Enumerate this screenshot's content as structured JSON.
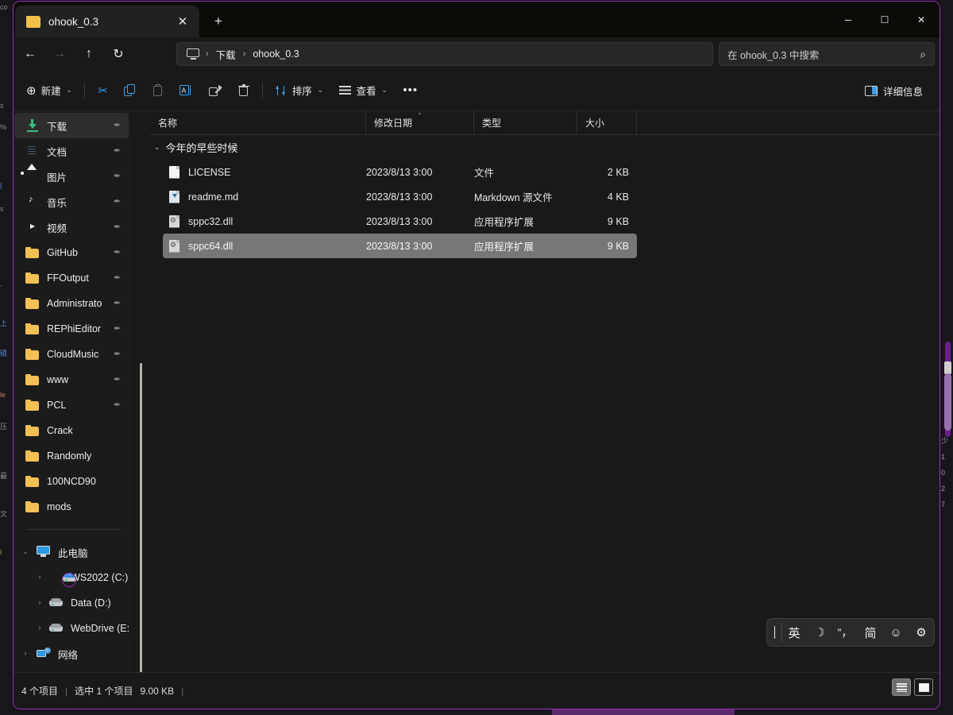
{
  "window": {
    "tab_title": "ohook_0.3",
    "tab_close": "✕",
    "new_tab": "+",
    "minimize": "─",
    "maximize": "☐",
    "close": "✕"
  },
  "nav": {
    "back": "←",
    "forward": "→",
    "up": "↑",
    "refresh": "↻",
    "breadcrumb": [
      "下载",
      "ohook_0.3"
    ],
    "separator": "›",
    "search_placeholder": "在 ohook_0.3 中搜索",
    "search_icon": "⌕"
  },
  "toolbar": {
    "new_label": "新建",
    "cut_label": "",
    "copy_label": "",
    "paste_label": "",
    "rename_label": "",
    "share_label": "",
    "delete_label": "",
    "sort_label": "排序",
    "view_label": "查看",
    "more_label": "•••",
    "details_label": "详细信息",
    "chevron": "⌄"
  },
  "sidebar": {
    "quick_access": [
      {
        "label": "下载",
        "icon": "download-icon",
        "pinned": true,
        "selected": true
      },
      {
        "label": "文档",
        "icon": "documents-icon",
        "pinned": true,
        "selected": false
      },
      {
        "label": "图片",
        "icon": "pictures-icon",
        "pinned": true,
        "selected": false
      },
      {
        "label": "音乐",
        "icon": "music-icon",
        "pinned": true,
        "selected": false
      },
      {
        "label": "视频",
        "icon": "videos-icon",
        "pinned": true,
        "selected": false
      },
      {
        "label": "GitHub",
        "icon": "folder-icon",
        "pinned": true,
        "selected": false
      },
      {
        "label": "FFOutput",
        "icon": "folder-icon",
        "pinned": true,
        "selected": false
      },
      {
        "label": "Administrato",
        "icon": "folder-icon",
        "pinned": true,
        "selected": false
      },
      {
        "label": "REPhiEditor",
        "icon": "folder-icon",
        "pinned": true,
        "selected": false
      },
      {
        "label": "CloudMusic",
        "icon": "folder-icon",
        "pinned": true,
        "selected": false
      },
      {
        "label": "www",
        "icon": "folder-icon",
        "pinned": true,
        "selected": false
      },
      {
        "label": "PCL",
        "icon": "folder-icon",
        "pinned": true,
        "selected": false
      },
      {
        "label": "Crack",
        "icon": "folder-icon",
        "pinned": false,
        "selected": false
      },
      {
        "label": "Randomly",
        "icon": "folder-icon",
        "pinned": false,
        "selected": false
      },
      {
        "label": "100NCD90",
        "icon": "folder-icon",
        "pinned": false,
        "selected": false
      },
      {
        "label": "mods",
        "icon": "folder-icon",
        "pinned": false,
        "selected": false
      }
    ],
    "this_pc": {
      "label": "此电脑",
      "icon": "pc-icon",
      "expanded": true,
      "chevron": "⌄"
    },
    "drives": [
      {
        "label": "WS2022 (C:)",
        "icon": "windows-drive-icon",
        "chevron": "›"
      },
      {
        "label": "Data (D:)",
        "icon": "drive-icon",
        "chevron": "›"
      },
      {
        "label": "WebDrive (E:)",
        "icon": "drive-icon",
        "chevron": "›"
      }
    ],
    "network": {
      "label": "网络",
      "icon": "network-icon",
      "chevron": "›"
    },
    "pin_glyph": "✒"
  },
  "filelist": {
    "columns": [
      {
        "label": "名称",
        "key": "name"
      },
      {
        "label": "修改日期",
        "key": "date",
        "sorted": true,
        "sort_glyph": "⌄"
      },
      {
        "label": "类型",
        "key": "type"
      },
      {
        "label": "大小",
        "key": "size"
      }
    ],
    "group_label": "今年的早些时候",
    "group_chevron": "⌄",
    "rows": [
      {
        "name": "LICENSE",
        "date": "2023/8/13 3:00",
        "type": "文件",
        "size": "2 KB",
        "icon": "file-icon",
        "selected": false
      },
      {
        "name": "readme.md",
        "date": "2023/8/13 3:00",
        "type": "Markdown 源文件",
        "size": "4 KB",
        "icon": "markdown-icon",
        "selected": false
      },
      {
        "name": "sppc32.dll",
        "date": "2023/8/13 3:00",
        "type": "应用程序扩展",
        "size": "9 KB",
        "icon": "dll-icon",
        "selected": false
      },
      {
        "name": "sppc64.dll",
        "date": "2023/8/13 3:00",
        "type": "应用程序扩展",
        "size": "9 KB",
        "icon": "dll-icon",
        "selected": true
      }
    ]
  },
  "statusbar": {
    "item_count": "4 个项目",
    "sep1": "|",
    "selection": "选中 1 个项目",
    "selection_size": "9.00 KB",
    "sep2": "|",
    "view_details_icon": "details-view-icon",
    "view_tiles_icon": "tiles-view-icon"
  },
  "ime": {
    "cursor": "",
    "lang": "英",
    "moon": "☽",
    "punct": "”，",
    "simplified": "简",
    "emoji": "☺",
    "settings": "⚙"
  },
  "background": {
    "left_fragments": [
      "co",
      "s",
      "%",
      "|",
      "s",
      ",",
      "上",
      "硕",
      "le",
      "压",
      "最",
      "文",
      "i",
      "."
    ],
    "right_fragments": [
      "少",
      "1",
      "0",
      "2",
      "7"
    ]
  },
  "colors": {
    "window_border": "#9b2fbe",
    "accent_blue": "#3aa0ea",
    "selection": "#777777",
    "sidebar_selected": "#2d2d2d",
    "surface": "#191919",
    "titlebar": "#0d0b06"
  }
}
